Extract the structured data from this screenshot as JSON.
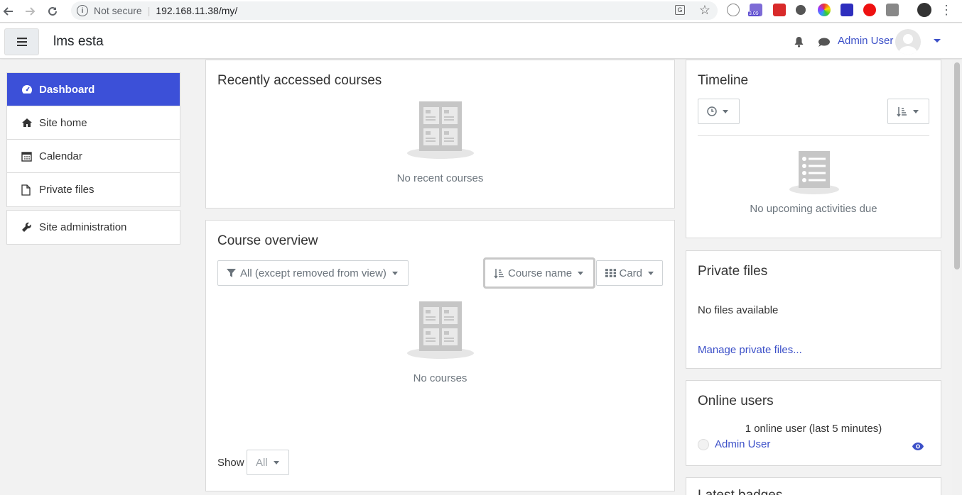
{
  "browser": {
    "security_label": "Not secure",
    "url": "192.168.11.38/my/",
    "extension_badge": "3.09"
  },
  "navbar": {
    "site_name": "lms esta",
    "user_name": "Admin User"
  },
  "sidebar": {
    "items": [
      {
        "label": "Dashboard",
        "icon": "dashboard-icon",
        "active": true
      },
      {
        "label": "Site home",
        "icon": "home-icon"
      },
      {
        "label": "Calendar",
        "icon": "calendar-icon"
      },
      {
        "label": "Private files",
        "icon": "file-icon"
      }
    ],
    "admin": {
      "label": "Site administration",
      "icon": "wrench-icon"
    }
  },
  "recent_courses": {
    "title": "Recently accessed courses",
    "empty_text": "No recent courses"
  },
  "course_overview": {
    "title": "Course overview",
    "filter_label": "All (except removed from view)",
    "sort_label": "Course name",
    "view_label": "Card",
    "empty_text": "No courses",
    "show_label": "Show",
    "show_value": "All"
  },
  "timeline": {
    "title": "Timeline",
    "empty_text": "No upcoming activities due"
  },
  "private_files": {
    "title": "Private files",
    "empty_text": "No files available",
    "manage_link": "Manage private files..."
  },
  "online_users": {
    "title": "Online users",
    "summary": "1 online user (last 5 minutes)",
    "users": [
      "Admin User"
    ]
  },
  "latest_badges": {
    "title": "Latest badges"
  },
  "colors": {
    "accent": "#3c50d8",
    "link": "#3c50c8"
  }
}
